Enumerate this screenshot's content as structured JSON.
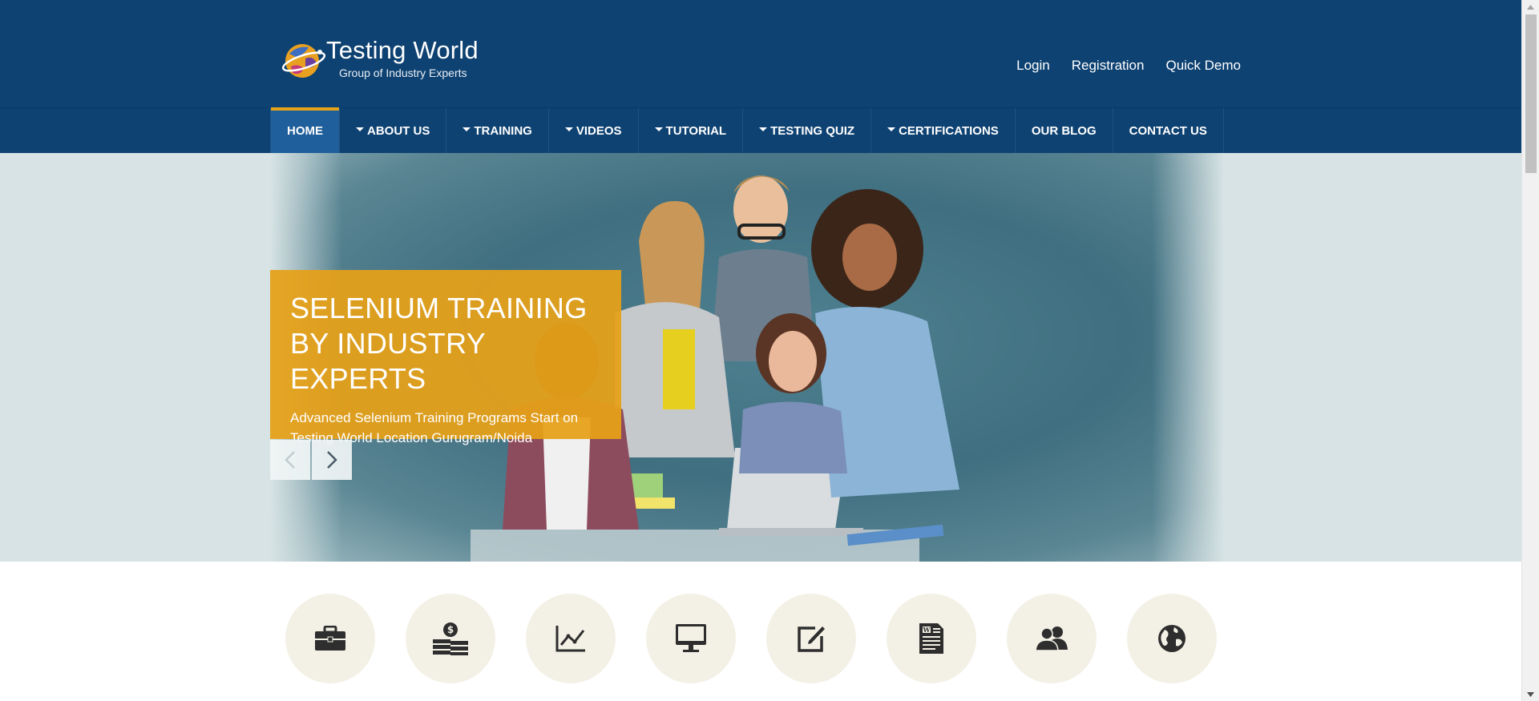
{
  "header": {
    "logo_title": "Testing World",
    "logo_subtitle": "Group of Industry Experts",
    "top_links": [
      "Login",
      "Registration",
      "Quick Demo"
    ]
  },
  "nav": {
    "items": [
      {
        "label": "HOME",
        "dropdown": false,
        "active": true
      },
      {
        "label": "ABOUT US",
        "dropdown": true
      },
      {
        "label": "TRAINING",
        "dropdown": true
      },
      {
        "label": "VIDEOS",
        "dropdown": true
      },
      {
        "label": "TUTORIAL",
        "dropdown": true
      },
      {
        "label": "TESTING QUIZ",
        "dropdown": true
      },
      {
        "label": "CERTIFICATIONS",
        "dropdown": true
      },
      {
        "label": "OUR BLOG",
        "dropdown": false
      },
      {
        "label": "CONTACT US",
        "dropdown": false
      }
    ]
  },
  "hero": {
    "title_line1": "SELENIUM TRAINING",
    "title_line2": "BY INDUSTRY EXPERTS",
    "text_line1": "Advanced Selenium Training Programs Start on",
    "text_line2": "Testing World Location Gurugram/Noida"
  },
  "features": {
    "icons": [
      "briefcase-icon",
      "money-icon",
      "line-chart-icon",
      "monitor-icon",
      "edit-icon",
      "document-icon",
      "users-icon",
      "globe-icon"
    ]
  },
  "colors": {
    "header_bg": "#0e4272",
    "accent": "#e3a218",
    "caption_bg": "#e6a018",
    "feature_circle": "#f3f1e6"
  }
}
